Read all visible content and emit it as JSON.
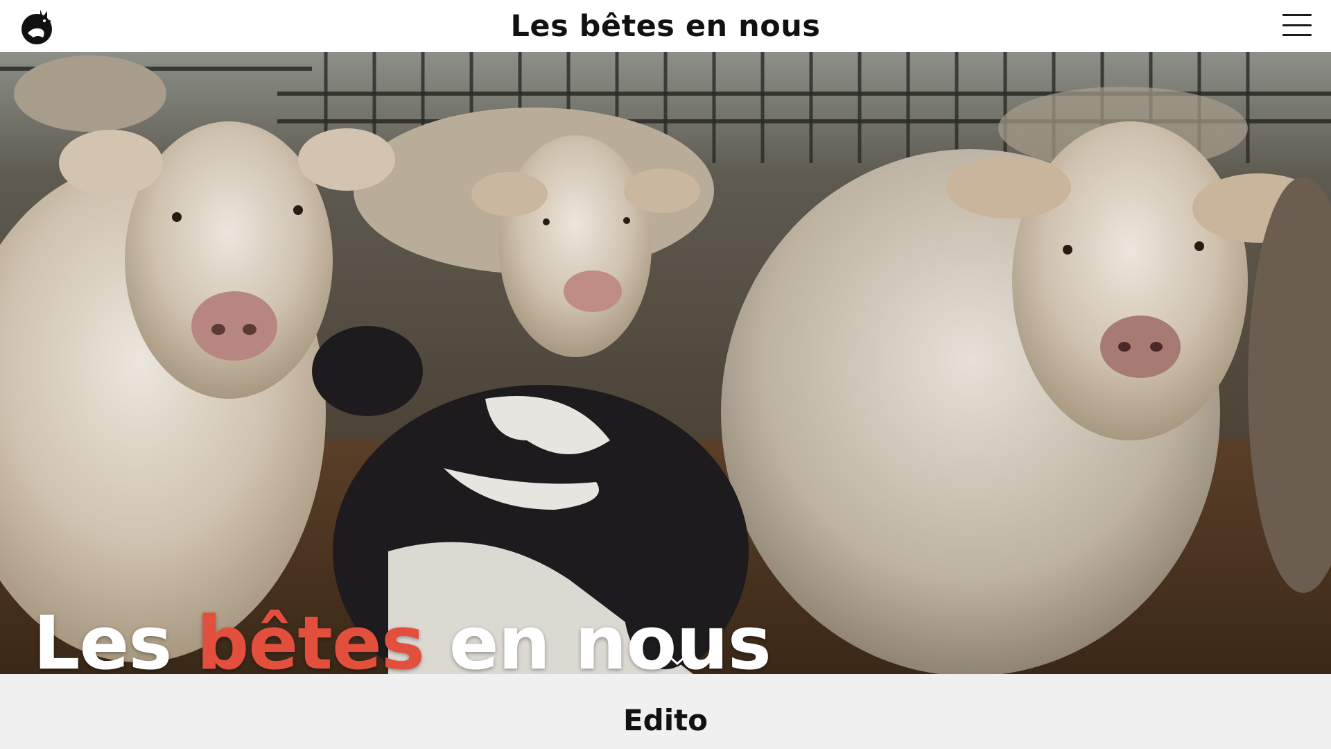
{
  "header": {
    "site_title": "Les bêtes en nous",
    "logo_icon": "cat-silhouette-icon",
    "menu_icon": "hamburger-menu-icon"
  },
  "hero": {
    "image_subject": "herd of cattle in barn",
    "title_part1": "Les ",
    "title_accent": "bêtes",
    "title_part2": " en nous",
    "scroll_icon": "chevron-down-icon"
  },
  "section": {
    "title": "Edito"
  },
  "colors": {
    "accent": "#e24f3d",
    "header_bg": "#ffffff",
    "section_bg": "#f0f0f0",
    "text": "#111111"
  }
}
